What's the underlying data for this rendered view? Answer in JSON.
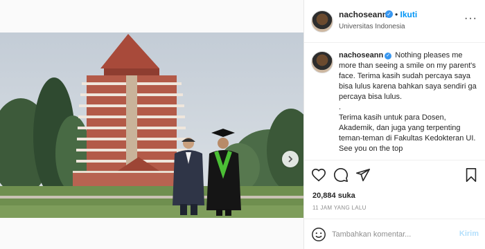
{
  "post": {
    "username": "nachoseann",
    "follow_label": "Ikuti",
    "separator": "•",
    "location": "Universitas Indonesia",
    "more_label": "···"
  },
  "caption": {
    "username": "nachoseann",
    "text": "Nothing pleases me more than seeing a smile on my parent's face. Terima kasih sudah percaya saya bisa lulus karena bahkan saya sendiri ga percaya bisa lulus.\n.\nTerima kasih untuk para Dosen, Akademik, dan juga yang terpenting teman-teman di Fakultas Kedokteran UI. See you on the top"
  },
  "actions": {
    "like_icon": "heart-icon",
    "comment_icon": "comment-icon",
    "share_icon": "share-icon",
    "save_icon": "bookmark-icon"
  },
  "likes": "20,884 suka",
  "timestamp": "11 JAM YANG LALU",
  "comment": {
    "placeholder": "Tambahkan komentar...",
    "post_label": "Kirim"
  },
  "carousel": {
    "dots": 3,
    "active_index": 0
  },
  "colors": {
    "accent": "#0095f6",
    "verified": "#3897f0"
  }
}
